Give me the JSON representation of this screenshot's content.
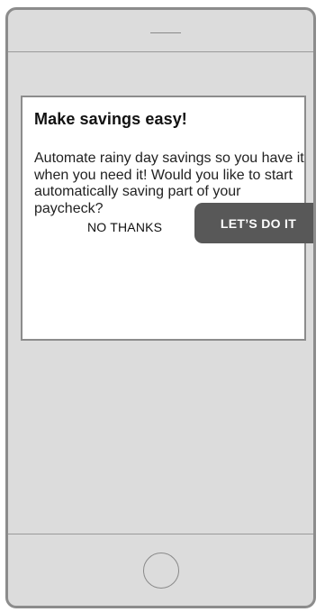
{
  "dialog": {
    "title": "Make savings easy!",
    "body": "Automate rainy day savings so you have it when you need it! Would you like to start automatically saving part of your paycheck?",
    "decline_label": "NO THANKS",
    "accept_label": "LET’S DO IT"
  },
  "colors": {
    "screen_background": "#dcdcdc",
    "dialog_background": "#ffffff",
    "accept_button": "#585858",
    "frame": "#8c8c8c"
  },
  "icons": {
    "speaker": "speaker-slot-icon",
    "home": "home-button-icon"
  }
}
